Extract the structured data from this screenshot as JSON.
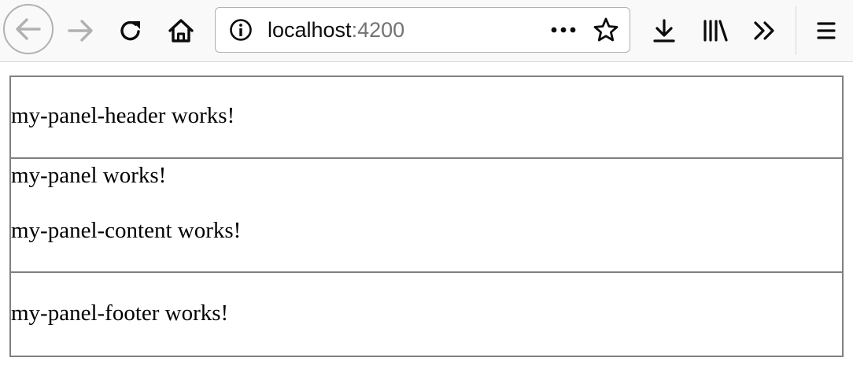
{
  "browser": {
    "url": {
      "host": "localhost",
      "port": ":4200"
    },
    "icons": {
      "back": "arrow-left-icon",
      "forward": "arrow-right-icon",
      "reload": "reload-icon",
      "home": "home-icon",
      "info": "info-icon",
      "more": "ellipsis-icon",
      "bookmark": "star-icon",
      "downloads": "download-icon",
      "library": "library-icon",
      "overflow": "double-chevron-icon",
      "menu": "hamburger-icon"
    },
    "colors": {
      "toolbar_bg": "#f9f9fa",
      "icon": "#0c0c0d",
      "icon_disabled": "#b1b1b3",
      "url_port": "#737373"
    }
  },
  "page": {
    "header_text": "my-panel-header works!",
    "panel_text": "my-panel works!",
    "content_text": "my-panel-content works!",
    "footer_text": "my-panel-footer works!",
    "border_color": "#808080"
  }
}
